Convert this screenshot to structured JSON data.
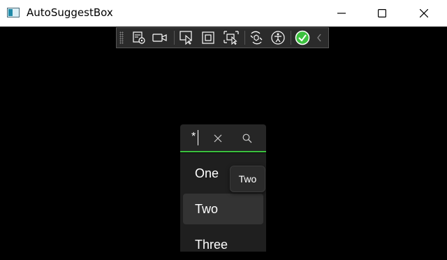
{
  "window": {
    "title": "AutoSuggestBox",
    "icon": "app-window-icon"
  },
  "debug_toolbar": {
    "tools": [
      {
        "name": "live-visual-tree-icon"
      },
      {
        "name": "video-camera-icon"
      },
      {
        "name": "select-element-icon"
      },
      {
        "name": "display-layout-adorners-icon"
      },
      {
        "name": "track-focus-icon"
      },
      {
        "name": "hot-reload-icon"
      },
      {
        "name": "accessibility-icon"
      },
      {
        "name": "checkmark-status-icon"
      },
      {
        "name": "collapse-chevron-icon"
      }
    ],
    "status_color": "#3cc13f"
  },
  "search_box": {
    "query": "*",
    "accent_color": "#3cc13f"
  },
  "suggestions": {
    "items": [
      "One",
      "Two",
      "Three"
    ],
    "selected": "Two",
    "tooltip": "Two"
  }
}
